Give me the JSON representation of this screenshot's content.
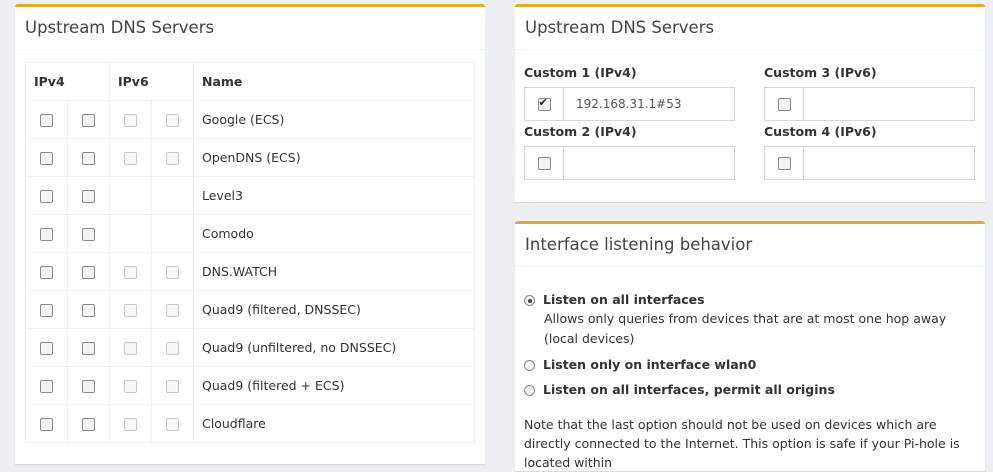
{
  "left_box": {
    "title": "Upstream DNS Servers",
    "headers": {
      "ipv4": "IPv4",
      "ipv6": "IPv6",
      "name": "Name"
    },
    "servers": [
      {
        "name": "Google (ECS)",
        "ipv6_available": true
      },
      {
        "name": "OpenDNS (ECS)",
        "ipv6_available": true
      },
      {
        "name": "Level3",
        "ipv6_available": false
      },
      {
        "name": "Comodo",
        "ipv6_available": false
      },
      {
        "name": "DNS.WATCH",
        "ipv6_available": true
      },
      {
        "name": "Quad9 (filtered, DNSSEC)",
        "ipv6_available": true
      },
      {
        "name": "Quad9 (unfiltered, no DNSSEC)",
        "ipv6_available": true
      },
      {
        "name": "Quad9 (filtered + ECS)",
        "ipv6_available": true
      },
      {
        "name": "Cloudflare",
        "ipv6_available": true
      }
    ]
  },
  "custom_box": {
    "title": "Upstream DNS Servers",
    "custom1": {
      "label": "Custom 1 (IPv4)",
      "checked": true,
      "value": "192.168.31.1#53"
    },
    "custom2": {
      "label": "Custom 2 (IPv4)",
      "checked": false,
      "value": ""
    },
    "custom3": {
      "label": "Custom 3 (IPv6)",
      "checked": false,
      "value": ""
    },
    "custom4": {
      "label": "Custom 4 (IPv6)",
      "checked": false,
      "value": ""
    }
  },
  "interface_box": {
    "title": "Interface listening behavior",
    "options": [
      {
        "label": "Listen on all interfaces",
        "checked": true,
        "description": "Allows only queries from devices that are at most one hop away (local devices)"
      },
      {
        "label": "Listen only on interface wlan0",
        "checked": false
      },
      {
        "label": "Listen on all interfaces, permit all origins",
        "checked": false
      }
    ],
    "note": "Note that the last option should not be used on devices which are directly connected to the Internet. This option is safe if your Pi-hole is located within"
  }
}
